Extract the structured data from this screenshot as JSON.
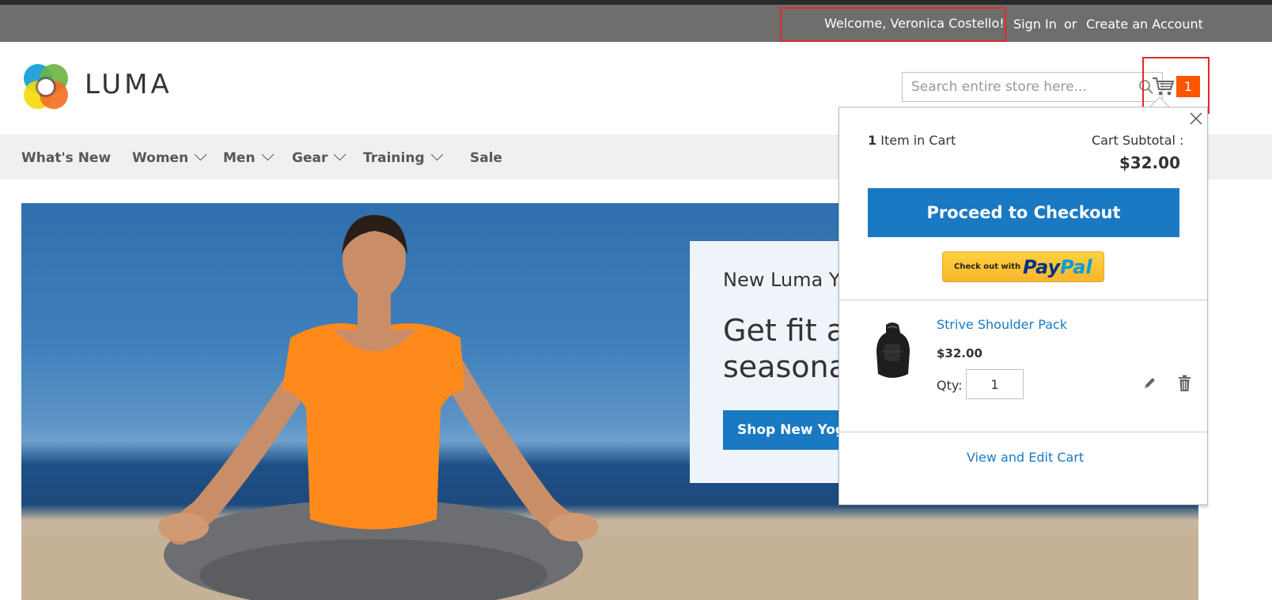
{
  "header": {
    "welcome": "Welcome, Veronica Costello!",
    "sign_in": "Sign In",
    "or": "or",
    "create_account": "Create an Account"
  },
  "logo": {
    "text": "LUMA"
  },
  "search": {
    "placeholder": "Search entire store here..."
  },
  "minicart": {
    "count": "1",
    "items_count_number": "1",
    "items_count_label": " Item in Cart",
    "subtotal_label": "Cart Subtotal :",
    "subtotal_value": "$32.00",
    "checkout_label": "Proceed to Checkout",
    "paypal_small": "Check out with",
    "paypal_brand_1": "Pay",
    "paypal_brand_2": "Pal",
    "item": {
      "name": "Strive Shoulder Pack",
      "price": "$32.00",
      "qty_label": "Qty:",
      "qty": "1"
    },
    "view_cart": "View and Edit Cart"
  },
  "nav": {
    "items": [
      {
        "label": "What's New",
        "has_children": false
      },
      {
        "label": "Women",
        "has_children": true
      },
      {
        "label": "Men",
        "has_children": true
      },
      {
        "label": "Gear",
        "has_children": true
      },
      {
        "label": "Training",
        "has_children": true
      },
      {
        "label": "Sale",
        "has_children": false
      }
    ]
  },
  "hero": {
    "kicker": "New Luma Y",
    "title_line1": "Get fit ar",
    "title_line2": "seasona",
    "button": "Shop New Yoga"
  },
  "colors": {
    "header_bg": "#6e6e6c",
    "accent_blue": "#1979c3",
    "cart_badge": "#ff5501",
    "highlight_red": "#e02b27"
  }
}
